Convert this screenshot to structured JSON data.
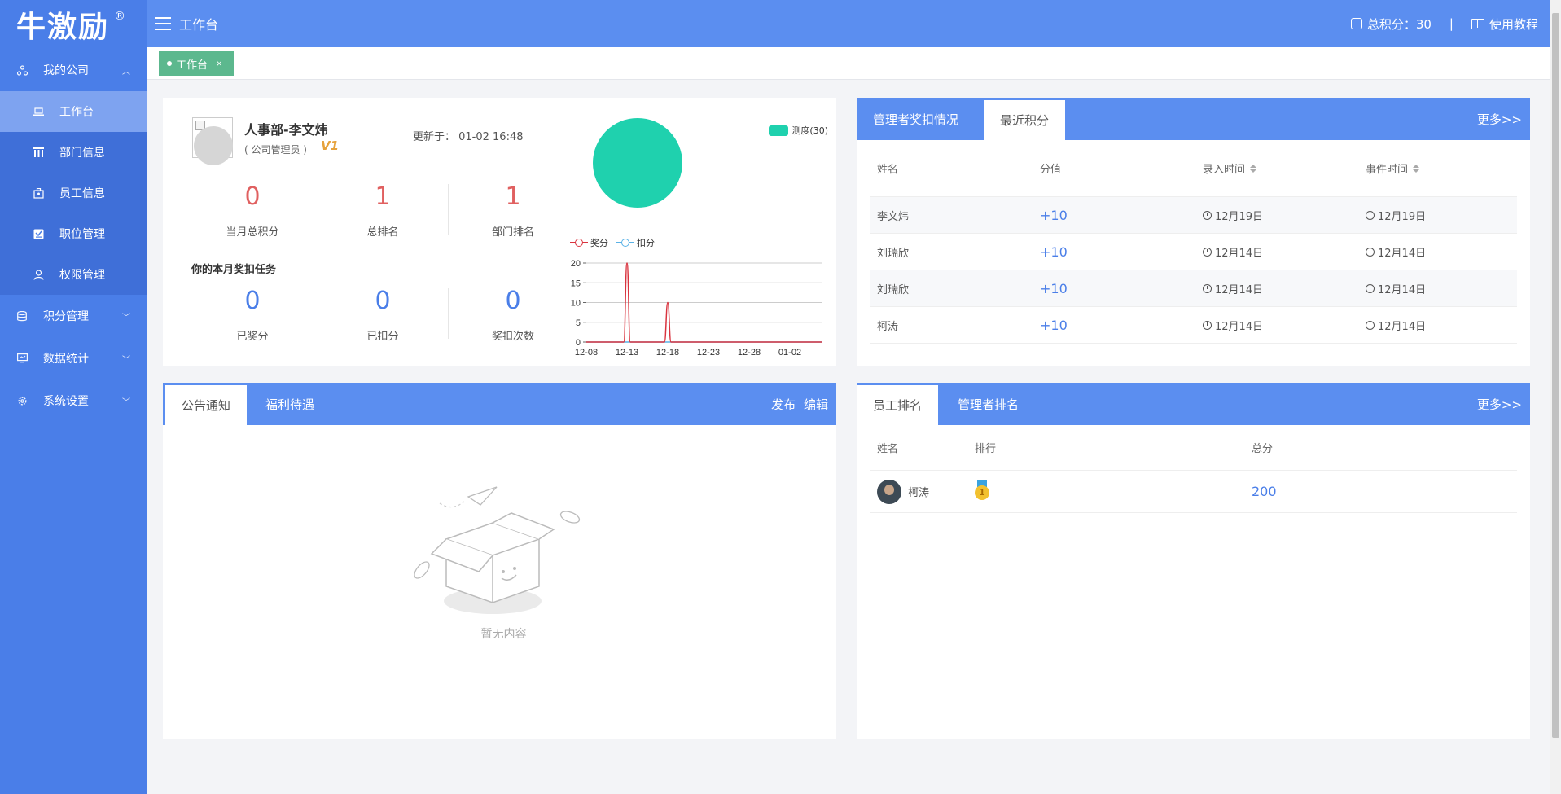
{
  "logo": {
    "text": "牛激励",
    "mark": "®"
  },
  "sidebar": {
    "groups": [
      {
        "label": "我的公司",
        "icon": "org-icon",
        "expanded": true,
        "items": [
          {
            "label": "工作台",
            "icon": "laptop-icon",
            "active": true
          },
          {
            "label": "部门信息",
            "icon": "columns-icon"
          },
          {
            "label": "员工信息",
            "icon": "employee-icon"
          },
          {
            "label": "职位管理",
            "icon": "position-icon"
          },
          {
            "label": "权限管理",
            "icon": "user-icon"
          }
        ]
      },
      {
        "label": "积分管理",
        "icon": "database-icon"
      },
      {
        "label": "数据统计",
        "icon": "monitor-icon"
      },
      {
        "label": "系统设置",
        "icon": "gear-icon"
      }
    ]
  },
  "topbar": {
    "title": "工作台",
    "total_points": "总积分：30",
    "separator": "|",
    "tutorial": "使用教程"
  },
  "page_tab": {
    "label": "工作台",
    "close": "×"
  },
  "profile": {
    "name": "人事部-李文炜",
    "role": "( 公司管理员 )",
    "level_badge": "V1",
    "updated": "更新于： 01-02 16:48",
    "stats": [
      {
        "value": "0",
        "label": "当月总积分"
      },
      {
        "value": "1",
        "label": "总排名"
      },
      {
        "value": "1",
        "label": "部门排名"
      }
    ],
    "task_title": "你的本月奖扣任务",
    "task_stats": [
      {
        "value": "0",
        "label": "已奖分"
      },
      {
        "value": "0",
        "label": "已扣分"
      },
      {
        "value": "0",
        "label": "奖扣次数"
      }
    ]
  },
  "chart_data": [
    {
      "type": "pie",
      "slices": [
        {
          "name": "测度(30)",
          "value": 30,
          "color": "#1fd1ae"
        }
      ],
      "legend_position": "top-right"
    },
    {
      "type": "line",
      "x": [
        "12-08",
        "12-13",
        "12-18",
        "12-23",
        "12-28",
        "01-02"
      ],
      "ylim": [
        0,
        20
      ],
      "yticks": [
        0,
        5,
        10,
        15,
        20
      ],
      "series": [
        {
          "name": "奖分",
          "color": "#d9343f",
          "points": [
            [
              0,
              0
            ],
            [
              4.6,
              0
            ],
            [
              5,
              20
            ],
            [
              5.4,
              0
            ],
            [
              9.6,
              0
            ],
            [
              10,
              10
            ],
            [
              10.4,
              0
            ],
            [
              29,
              0
            ]
          ]
        },
        {
          "name": "扣分",
          "color": "#5ab2e6",
          "points": [
            [
              0,
              0
            ],
            [
              29,
              0
            ]
          ]
        }
      ],
      "grid": true,
      "legend_position": "top-left"
    }
  ],
  "recent": {
    "tabs": [
      "管理者奖扣情况",
      "最近积分"
    ],
    "more": "更多>>",
    "headers": [
      "姓名",
      "分值",
      "录入时间",
      "事件时间"
    ],
    "rows": [
      {
        "name": "李文炜",
        "score": "+10",
        "entry": "12月19日",
        "event": "12月19日"
      },
      {
        "name": "刘瑞欣",
        "score": "+10",
        "entry": "12月14日",
        "event": "12月14日"
      },
      {
        "name": "刘瑞欣",
        "score": "+10",
        "entry": "12月14日",
        "event": "12月14日"
      },
      {
        "name": "柯涛",
        "score": "+10",
        "entry": "12月14日",
        "event": "12月14日"
      }
    ]
  },
  "notice": {
    "tabs": [
      "公告通知",
      "福利待遇"
    ],
    "publish": "发布",
    "edit": "编辑",
    "empty": "暂无内容"
  },
  "ranking": {
    "tabs": [
      "员工排名",
      "管理者排名"
    ],
    "more": "更多>>",
    "headers": [
      "姓名",
      "排行",
      "总分"
    ],
    "rows": [
      {
        "name": "柯涛",
        "rank": "1",
        "total": "200"
      }
    ]
  }
}
